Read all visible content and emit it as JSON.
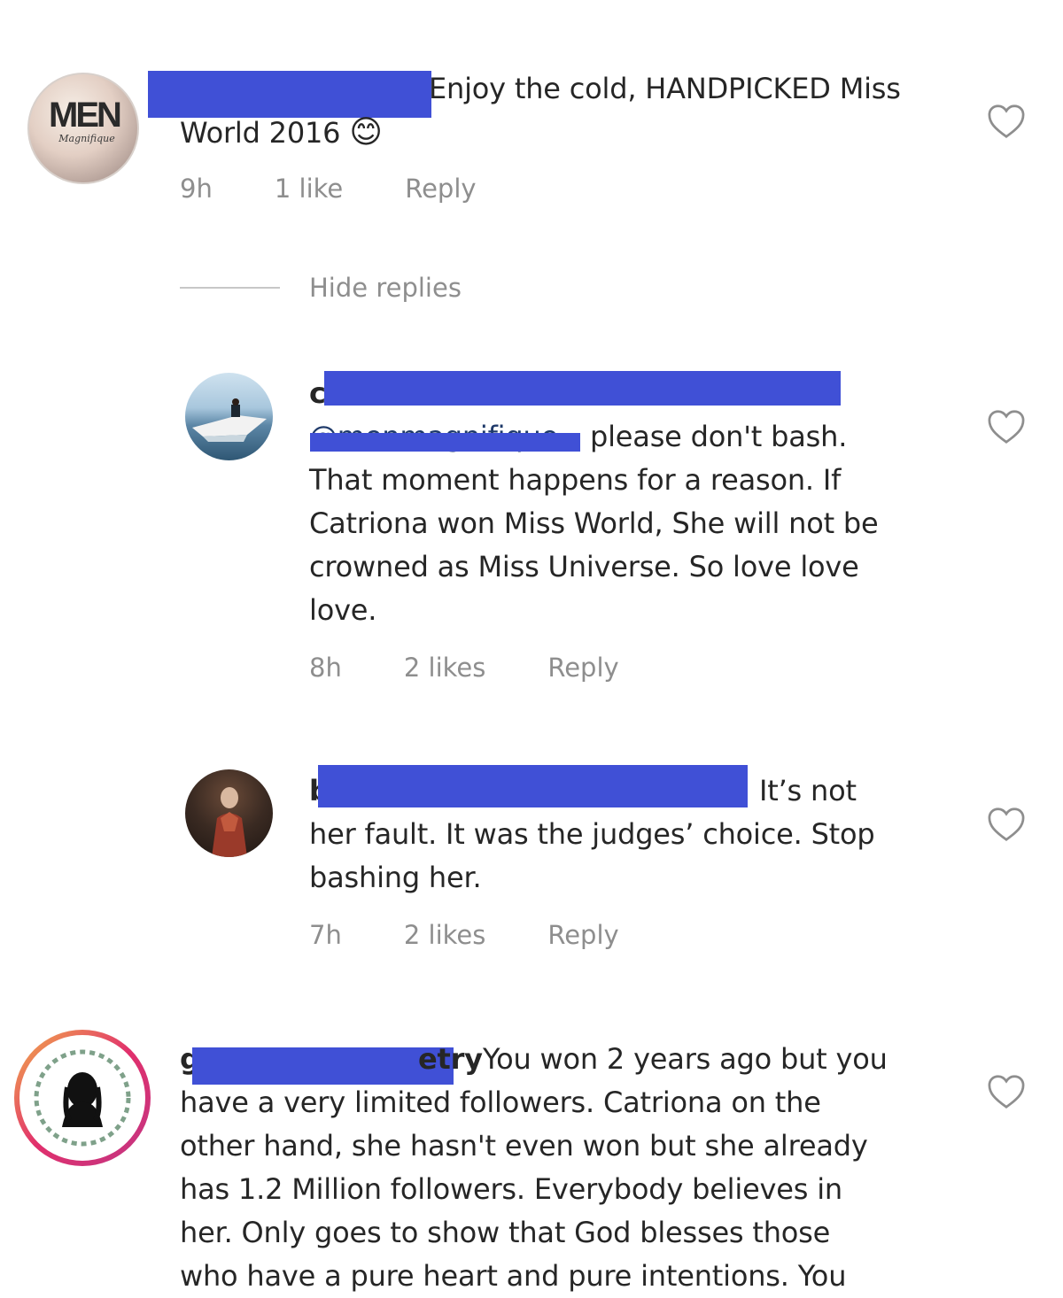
{
  "comments": [
    {
      "text_after_redaction": "Enjoy the cold, HANDPICKED Miss",
      "text_line2": "World 2016",
      "emoji": "😊",
      "time": "9h",
      "likes": "1 like",
      "reply": "Reply",
      "avatar_text": "MEN",
      "avatar_subtext": "Magnifique"
    },
    {
      "username_initial": "c",
      "mention_partial": "@menmagnifique",
      "text_line1": "please don't bash.",
      "text_lines": [
        "That moment happens for a reason. If",
        "Catriona won Miss World,  She will not be",
        "crowned as Miss Universe.  So love love",
        "love."
      ],
      "time": "8h",
      "likes": "2 likes",
      "reply": "Reply"
    },
    {
      "username_initial": "b",
      "text_line1_tail": "It’s not",
      "text_lines": [
        "her fault. It was the judges’ choice. Stop",
        "bashing her."
      ],
      "time": "7h",
      "likes": "2 likes",
      "reply": "Reply"
    },
    {
      "username_initial": "g",
      "username_tail": "etry",
      "text_line1_tail": "You won 2 years ago but you",
      "text_lines": [
        "have a very limited followers. Catriona on the",
        "other hand, she hasn't even won but she already",
        "has 1.2 Million followers. Everybody believes in",
        "her. Only goes to show that God blesses those",
        "who have a pure heart and pure intentions. You"
      ]
    }
  ],
  "hide_replies": "Hide replies",
  "colors": {
    "redaction": "#4050d6",
    "meta": "#8e8e8e",
    "text": "#262626"
  },
  "icons": [
    "heart-icon"
  ]
}
